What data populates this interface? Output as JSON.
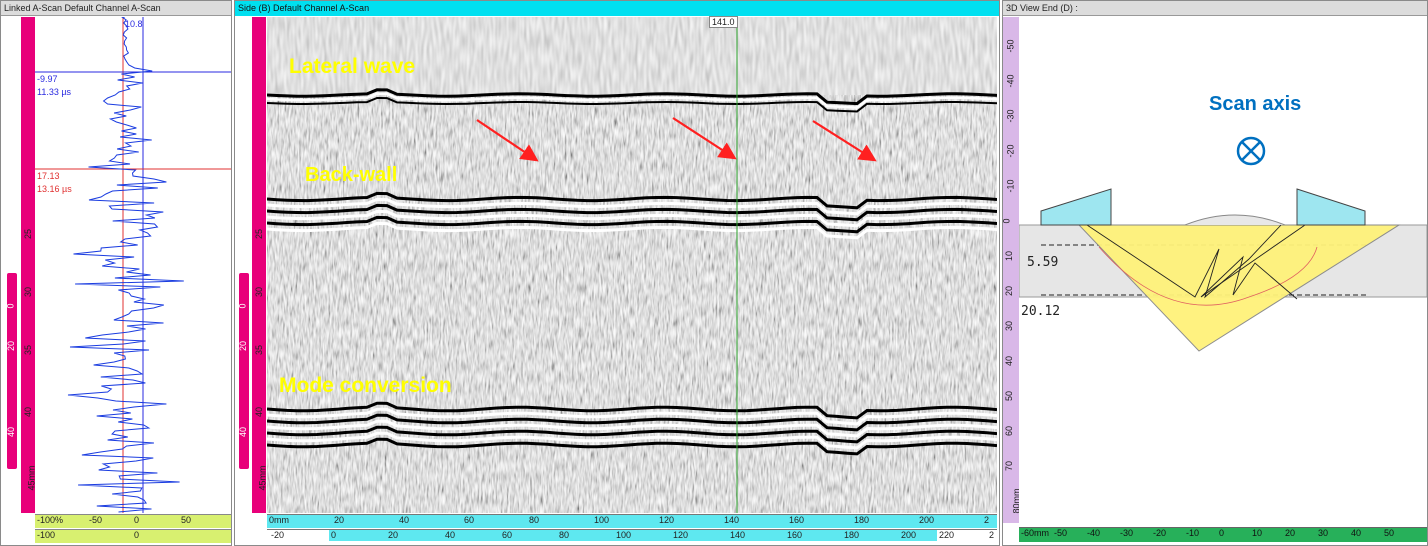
{
  "panels": {
    "ascan": {
      "title": "Linked A-Scan Default Channel A-Scan"
    },
    "bscan": {
      "title": "Side (B) Default Channel A-Scan"
    },
    "view3d": {
      "title": "3D View End (D) :"
    }
  },
  "ascan": {
    "top_value": "10.8",
    "cursor_blue": {
      "amp": "-9.97",
      "time": "11.33 µs"
    },
    "cursor_red": {
      "amp": "17.13",
      "time": "13.16 µs"
    },
    "left_depth_labels": [
      "25",
      "30",
      "35",
      "40",
      "45mm"
    ],
    "left_index_labels": [
      "0",
      "20",
      "40"
    ],
    "amp_ruler_top": [
      "-100%",
      "-50",
      "0",
      "50"
    ],
    "amp_ruler_bottom": [
      "-100",
      "0"
    ]
  },
  "bscan": {
    "cursor_value": "141.0",
    "annotations": {
      "lateral_wave": "Lateral wave",
      "back_wall": "Back-wall",
      "mode_conversion": "Mode conversion"
    },
    "depth_labels": [
      "25",
      "30",
      "35",
      "40",
      "45mm"
    ],
    "index_labels": [
      "0",
      "20",
      "40"
    ],
    "scan_ruler": [
      "0mm",
      "20",
      "40",
      "60",
      "80",
      "100",
      "120",
      "140",
      "160",
      "180",
      "200",
      "2"
    ],
    "bottom_ruler_left": [
      "-20"
    ],
    "bottom_ruler": [
      "0",
      "20",
      "40",
      "60",
      "80",
      "100",
      "120",
      "140",
      "160",
      "180",
      "200"
    ],
    "bottom_ruler_right": [
      "220",
      "2"
    ]
  },
  "view3d": {
    "scan_axis_label": "Scan axis",
    "depth_value_1": "5.59",
    "depth_value_2": "20.12",
    "depth_ruler": [
      "-50",
      "-40",
      "-30",
      "-20",
      "-10",
      "0",
      "10",
      "20",
      "30",
      "40",
      "50",
      "60",
      "70",
      "80mm"
    ],
    "index_ruler": [
      "-60mm",
      "-50",
      "-40",
      "-30",
      "-20",
      "-10",
      "0",
      "10",
      "20",
      "30",
      "40",
      "50"
    ]
  },
  "colors": {
    "active_title": "#00e0f0",
    "magenta_bar": "#e8007a",
    "annotation_yellow": "#ffff00",
    "scan_axis_blue": "#0070c0",
    "wedge": "#9ee6f0",
    "beam": "#fff27a"
  },
  "icons": {
    "scan_axis": "circle-cross-icon",
    "arrows": "red-arrow-icon"
  }
}
